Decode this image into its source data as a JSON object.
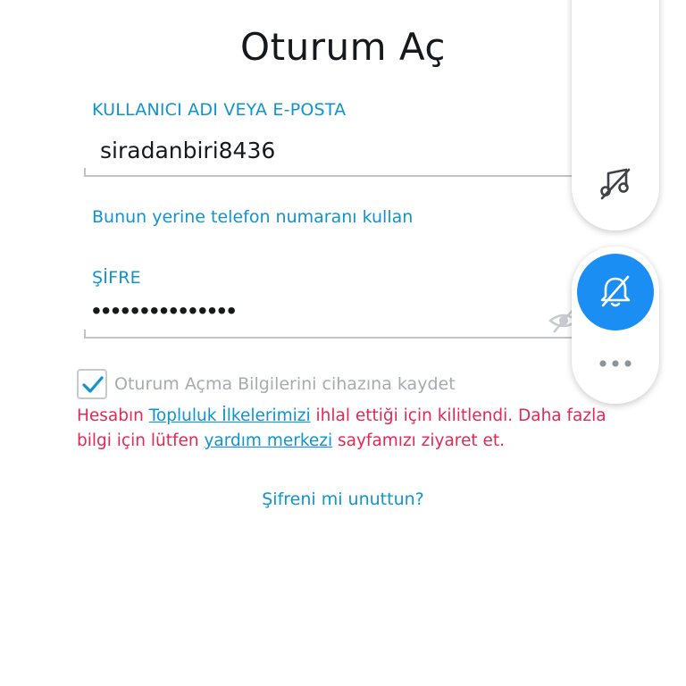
{
  "page": {
    "title": "Oturum Aç"
  },
  "username": {
    "label": "KULLANICI ADI VEYA E-POSTA",
    "value": "siradanbiri8436"
  },
  "phone_link": "Bunun yerine telefon numaranı kullan",
  "password": {
    "label": "ŞİFRE",
    "masked_value": "•••••••••••••••",
    "toggle_icon": "eye-icon"
  },
  "remember": {
    "label": "Oturum Açma Bilgilerini cihazına kaydet",
    "checked": true
  },
  "error": {
    "part1": "Hesabın ",
    "link1": "Topluluk İlkelerimizi",
    "part2": " ihlal ettiği için kilitlendi. Daha fazla bilgi için lütfen ",
    "link2": "yardım merkezi",
    "part3": " sayfamızı ziyaret et."
  },
  "forgot_link": "Şifreni mi unuttun?",
  "side_panel": {
    "top_icon": "music-note-slash-icon",
    "bell_icon": "bell-slash-icon",
    "more_icon": "more-dots-icon"
  },
  "colors": {
    "accent": "#0f94d1",
    "error": "#e42a54",
    "text": "#16191c",
    "muted": "#a5abb1",
    "bell_bg": "#1a8ef2"
  }
}
